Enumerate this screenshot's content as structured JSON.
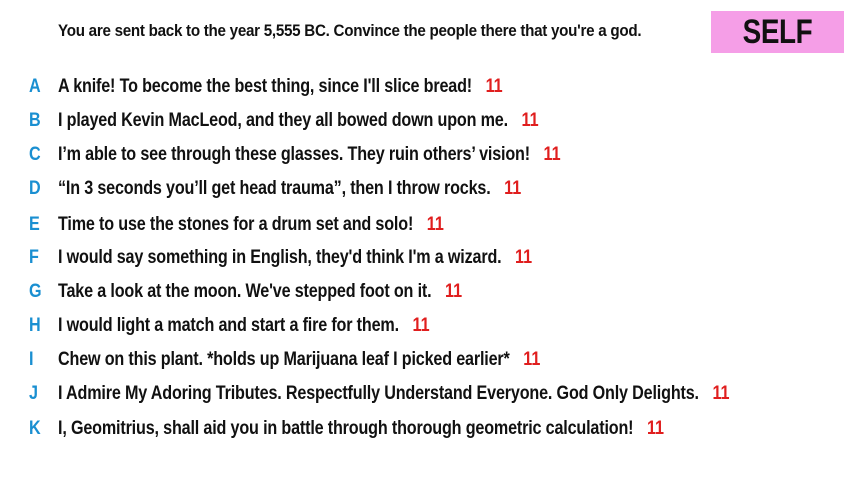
{
  "prompt": "You are sent back to the year 5,555 BC. Convince the people there that you're a god.",
  "badge": "SELF",
  "colors": {
    "badge_bg": "#f59ee7",
    "letter": "#1a8fd1",
    "score": "#e01e1e",
    "text": "#111111"
  },
  "answers": [
    {
      "letter": "A",
      "text": "A knife! To become the best thing, since I'll slice bread!",
      "score": "11"
    },
    {
      "letter": "B",
      "text": "I played Kevin MacLeod, and they all bowed down upon me.",
      "score": "11"
    },
    {
      "letter": "C",
      "text": "I’m able to see through these glasses. They ruin others’ vision!",
      "score": "11"
    },
    {
      "letter": "D",
      "text": "“In 3 seconds you’ll get head trauma”, then I throw rocks.",
      "score": "11"
    },
    {
      "letter": "E",
      "text": "Time to use the stones for a drum set and solo!",
      "score": "11"
    },
    {
      "letter": "F",
      "text": "I would say something in English, they'd think I'm a wizard.",
      "score": "11"
    },
    {
      "letter": "G",
      "text": "Take a look at the moon. We've stepped foot on it.",
      "score": "11"
    },
    {
      "letter": "H",
      "text": "I would light a match and start a fire for them.",
      "score": "11"
    },
    {
      "letter": "I",
      "text": "Chew on this plant. *holds up Marijuana leaf I picked earlier*",
      "score": "11"
    },
    {
      "letter": "J",
      "text": "I Admire My Adoring Tributes. Respectfully Understand Everyone. God Only Delights.",
      "score": "11"
    },
    {
      "letter": "K",
      "text": "I, Geomitrius, shall aid you in battle through thorough geometric calculation!",
      "score": "11"
    }
  ]
}
